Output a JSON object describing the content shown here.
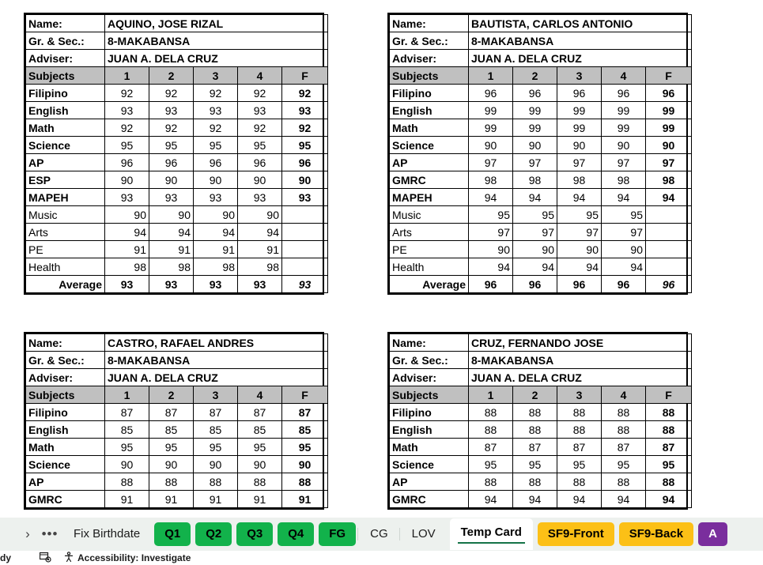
{
  "app": {
    "labels": {
      "name": "Name:",
      "grade_section": "Gr. & Sec.:",
      "adviser": "Adviser:",
      "subjects": "Subjects",
      "average": "Average"
    },
    "quarter_headers": [
      "1",
      "2",
      "3",
      "4",
      "F"
    ]
  },
  "cards": [
    {
      "position": "top-left",
      "name": "AQUINO, JOSE RIZAL",
      "grade_section": "8-MAKABANSA",
      "adviser": "JUAN A. DELA CRUZ",
      "subjects": [
        {
          "name": "Filipino",
          "q": [
            "92",
            "92",
            "92",
            "92"
          ],
          "f": "92"
        },
        {
          "name": "English",
          "q": [
            "93",
            "93",
            "93",
            "93"
          ],
          "f": "93"
        },
        {
          "name": "Math",
          "q": [
            "92",
            "92",
            "92",
            "92"
          ],
          "f": "92"
        },
        {
          "name": "Science",
          "q": [
            "95",
            "95",
            "95",
            "95"
          ],
          "f": "95"
        },
        {
          "name": "AP",
          "q": [
            "96",
            "96",
            "96",
            "96"
          ],
          "f": "96"
        },
        {
          "name": "ESP",
          "q": [
            "90",
            "90",
            "90",
            "90"
          ],
          "f": "90"
        },
        {
          "name": "MAPEH",
          "q": [
            "93",
            "93",
            "93",
            "93"
          ],
          "f": "93"
        }
      ],
      "components": [
        {
          "name": "Music",
          "q": [
            "90",
            "90",
            "90",
            "90"
          ],
          "f": ""
        },
        {
          "name": "Arts",
          "q": [
            "94",
            "94",
            "94",
            "94"
          ],
          "f": ""
        },
        {
          "name": "PE",
          "q": [
            "91",
            "91",
            "91",
            "91"
          ],
          "f": ""
        },
        {
          "name": "Health",
          "q": [
            "98",
            "98",
            "98",
            "98"
          ],
          "f": ""
        }
      ],
      "average": {
        "q": [
          "93",
          "93",
          "93",
          "93"
        ],
        "f": "93"
      },
      "truncated": false
    },
    {
      "position": "top-right",
      "name": "BAUTISTA, CARLOS ANTONIO",
      "grade_section": "8-MAKABANSA",
      "adviser": "JUAN A. DELA CRUZ",
      "subjects": [
        {
          "name": "Filipino",
          "q": [
            "96",
            "96",
            "96",
            "96"
          ],
          "f": "96"
        },
        {
          "name": "English",
          "q": [
            "99",
            "99",
            "99",
            "99"
          ],
          "f": "99"
        },
        {
          "name": "Math",
          "q": [
            "99",
            "99",
            "99",
            "99"
          ],
          "f": "99"
        },
        {
          "name": "Science",
          "q": [
            "90",
            "90",
            "90",
            "90"
          ],
          "f": "90"
        },
        {
          "name": "AP",
          "q": [
            "97",
            "97",
            "97",
            "97"
          ],
          "f": "97"
        },
        {
          "name": "GMRC",
          "q": [
            "98",
            "98",
            "98",
            "98"
          ],
          "f": "98"
        },
        {
          "name": "MAPEH",
          "q": [
            "94",
            "94",
            "94",
            "94"
          ],
          "f": "94"
        }
      ],
      "components": [
        {
          "name": "Music",
          "q": [
            "95",
            "95",
            "95",
            "95"
          ],
          "f": ""
        },
        {
          "name": "Arts",
          "q": [
            "97",
            "97",
            "97",
            "97"
          ],
          "f": ""
        },
        {
          "name": "PE",
          "q": [
            "90",
            "90",
            "90",
            "90"
          ],
          "f": ""
        },
        {
          "name": "Health",
          "q": [
            "94",
            "94",
            "94",
            "94"
          ],
          "f": ""
        }
      ],
      "average": {
        "q": [
          "96",
          "96",
          "96",
          "96"
        ],
        "f": "96"
      },
      "truncated": false
    },
    {
      "position": "bottom-left",
      "name": "CASTRO, RAFAEL ANDRES",
      "grade_section": "8-MAKABANSA",
      "adviser": "JUAN A. DELA CRUZ",
      "subjects": [
        {
          "name": "Filipino",
          "q": [
            "87",
            "87",
            "87",
            "87"
          ],
          "f": "87"
        },
        {
          "name": "English",
          "q": [
            "85",
            "85",
            "85",
            "85"
          ],
          "f": "85"
        },
        {
          "name": "Math",
          "q": [
            "95",
            "95",
            "95",
            "95"
          ],
          "f": "95"
        },
        {
          "name": "Science",
          "q": [
            "90",
            "90",
            "90",
            "90"
          ],
          "f": "90"
        },
        {
          "name": "AP",
          "q": [
            "88",
            "88",
            "88",
            "88"
          ],
          "f": "88"
        },
        {
          "name": "GMRC",
          "q": [
            "91",
            "91",
            "91",
            "91"
          ],
          "f": "91"
        }
      ],
      "components": [],
      "average": null,
      "truncated": true
    },
    {
      "position": "bottom-right",
      "name": "CRUZ, FERNANDO JOSE",
      "grade_section": "8-MAKABANSA",
      "adviser": "JUAN A. DELA CRUZ",
      "subjects": [
        {
          "name": "Filipino",
          "q": [
            "88",
            "88",
            "88",
            "88"
          ],
          "f": "88"
        },
        {
          "name": "English",
          "q": [
            "88",
            "88",
            "88",
            "88"
          ],
          "f": "88"
        },
        {
          "name": "Math",
          "q": [
            "87",
            "87",
            "87",
            "87"
          ],
          "f": "87"
        },
        {
          "name": "Science",
          "q": [
            "95",
            "95",
            "95",
            "95"
          ],
          "f": "95"
        },
        {
          "name": "AP",
          "q": [
            "88",
            "88",
            "88",
            "88"
          ],
          "f": "88"
        },
        {
          "name": "GMRC",
          "q": [
            "94",
            "94",
            "94",
            "94"
          ],
          "f": "94"
        }
      ],
      "components": [],
      "average": null,
      "truncated": true
    }
  ],
  "sheet_tabs": {
    "nav_next_icon": "chevron-right-icon",
    "overflow_icon": "ellipsis-icon",
    "items": [
      {
        "label": "Fix Birthdate",
        "style": "plain",
        "active": false
      },
      {
        "label": "Q1",
        "style": "green",
        "active": false
      },
      {
        "label": "Q2",
        "style": "green",
        "active": false
      },
      {
        "label": "Q3",
        "style": "green",
        "active": false
      },
      {
        "label": "Q4",
        "style": "green",
        "active": false
      },
      {
        "label": "FG",
        "style": "green",
        "active": false
      },
      {
        "label": "CG",
        "style": "plain",
        "active": false
      },
      {
        "label": "LOV",
        "style": "plain",
        "active": false
      },
      {
        "label": "Temp Card",
        "style": "active",
        "active": true
      },
      {
        "label": "SF9-Front",
        "style": "yellow",
        "active": false
      },
      {
        "label": "SF9-Back",
        "style": "yellow",
        "active": false
      },
      {
        "label": "A",
        "style": "purple",
        "active": false
      }
    ]
  },
  "status_bar": {
    "ready_text": "dy",
    "accessibility_text": "Accessibility: Investigate",
    "record_icon": "macro-record-icon",
    "accessibility_icon": "accessibility-person-icon"
  },
  "colors": {
    "green_tab": "#12b24b",
    "yellow_tab": "#fcc016",
    "purple_tab": "#7a2e9d",
    "active_underline": "#157347",
    "header_fill": "#c0c0c0",
    "tabbar_bg": "#edf1ee"
  }
}
